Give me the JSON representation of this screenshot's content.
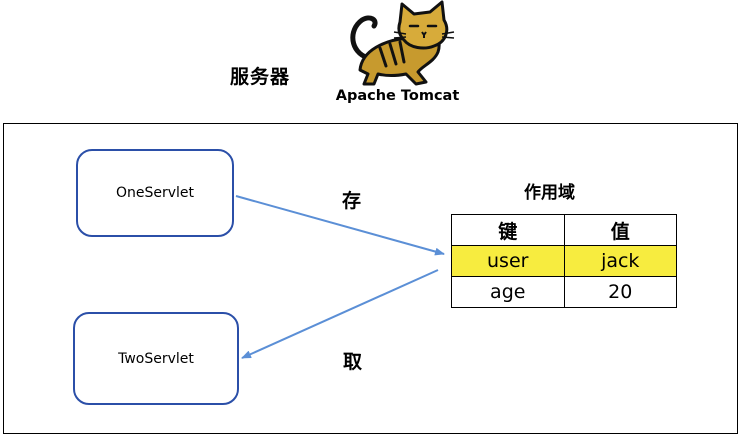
{
  "server_label": "服务器",
  "logo": {
    "text": "Apache Tomcat",
    "icon": "tomcat-cat-icon"
  },
  "servlets": {
    "one": "OneServlet",
    "two": "TwoServlet"
  },
  "operations": {
    "store": "存",
    "fetch": "取"
  },
  "scope": {
    "title": "作用域",
    "headers": [
      "键",
      "值"
    ],
    "rows": [
      {
        "key": "user",
        "value": "jack",
        "highlighted": true
      },
      {
        "key": "age",
        "value": "20",
        "highlighted": false
      }
    ]
  },
  "colors": {
    "arrow": "#5b8fd6",
    "box_border": "#2b4fa8",
    "highlight": "#f7ec3f",
    "cat_body": "#c79a2e"
  }
}
